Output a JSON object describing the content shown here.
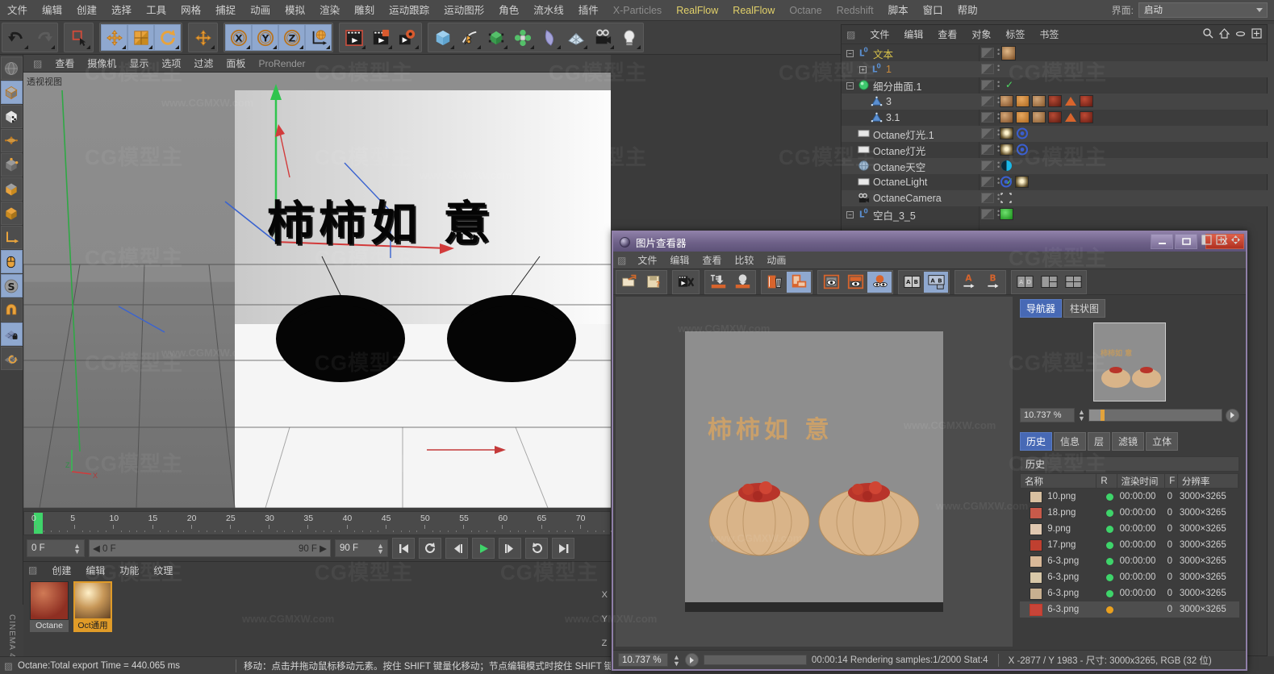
{
  "app": {
    "name": "CINEMA 4D"
  },
  "menubar": {
    "items": [
      {
        "label": "文件",
        "style": "normal"
      },
      {
        "label": "编辑",
        "style": "normal"
      },
      {
        "label": "创建",
        "style": "normal"
      },
      {
        "label": "选择",
        "style": "normal"
      },
      {
        "label": "工具",
        "style": "normal"
      },
      {
        "label": "网格",
        "style": "normal"
      },
      {
        "label": "捕捉",
        "style": "normal"
      },
      {
        "label": "动画",
        "style": "normal"
      },
      {
        "label": "模拟",
        "style": "normal"
      },
      {
        "label": "渲染",
        "style": "normal"
      },
      {
        "label": "雕刻",
        "style": "normal"
      },
      {
        "label": "运动跟踪",
        "style": "normal"
      },
      {
        "label": "运动图形",
        "style": "normal"
      },
      {
        "label": "角色",
        "style": "normal"
      },
      {
        "label": "流水线",
        "style": "normal"
      },
      {
        "label": "插件",
        "style": "normal"
      },
      {
        "label": "X-Particles",
        "style": "dim"
      },
      {
        "label": "RealFlow",
        "style": "accent"
      },
      {
        "label": "RealFlow",
        "style": "accent"
      },
      {
        "label": "Octane",
        "style": "dim"
      },
      {
        "label": "Redshift",
        "style": "dim"
      },
      {
        "label": "脚本",
        "style": "normal"
      },
      {
        "label": "窗口",
        "style": "normal"
      },
      {
        "label": "帮助",
        "style": "normal"
      }
    ],
    "interface_label": "界面:",
    "interface_value": "启动"
  },
  "toolbar": {
    "groups": [
      {
        "name": "undo-redo",
        "buttons": [
          {
            "name": "undo-icon"
          },
          {
            "name": "redo-icon"
          }
        ]
      },
      {
        "name": "select",
        "buttons": [
          {
            "name": "live-selection-icon"
          }
        ]
      },
      {
        "name": "transform",
        "buttons": [
          {
            "name": "move-icon",
            "active": true
          },
          {
            "name": "scale-icon",
            "active": true
          },
          {
            "name": "rotate-icon",
            "active": true
          }
        ]
      },
      {
        "name": "move-dup",
        "buttons": [
          {
            "name": "move-tool-icon"
          }
        ]
      },
      {
        "name": "axis-locks",
        "buttons": [
          {
            "name": "axis-x-icon",
            "active": true
          },
          {
            "name": "axis-y-icon",
            "active": true
          },
          {
            "name": "axis-z-icon",
            "active": true
          },
          {
            "name": "world-coordinate-icon",
            "active": true
          }
        ]
      },
      {
        "name": "render",
        "buttons": [
          {
            "name": "render-view-icon"
          },
          {
            "name": "render-to-picture-viewer-icon"
          },
          {
            "name": "render-settings-icon"
          }
        ]
      },
      {
        "name": "primitives",
        "buttons": [
          {
            "name": "cube-icon"
          },
          {
            "name": "spline-pen-icon"
          },
          {
            "name": "nurbs-icon"
          },
          {
            "name": "array-icon"
          },
          {
            "name": "bend-deformer-icon"
          },
          {
            "name": "floor-icon"
          },
          {
            "name": "camera-icon"
          },
          {
            "name": "light-icon"
          }
        ]
      }
    ]
  },
  "left_tools": {
    "items": [
      {
        "name": "world-axis-icon",
        "active": false
      },
      {
        "name": "model-mode-icon",
        "active": true
      },
      {
        "name": "texture-mode-icon",
        "active": false
      },
      {
        "name": "points-mode-icon",
        "active": false
      },
      {
        "name": "edges-mode-icon",
        "active": false
      },
      {
        "name": "polygons-mode-icon",
        "active": false
      },
      {
        "name": "object-axis-icon",
        "active": false
      },
      {
        "name": "enable-axis-icon",
        "active": false
      },
      {
        "name": "viewport-solo-icon",
        "active": true
      },
      {
        "name": "snap-icon",
        "active": true
      },
      {
        "name": "magnet-icon",
        "active": false
      },
      {
        "name": "workplane-lock-icon",
        "active": true
      },
      {
        "name": "workplane-icon",
        "active": false
      }
    ]
  },
  "viewport": {
    "menu": [
      "查看",
      "摄像机",
      "显示",
      "选项",
      "过滤",
      "面板",
      "ProRender"
    ],
    "label": "透视视图",
    "scene_text": "柿柿如 意"
  },
  "timeline": {
    "ticks": [
      "0",
      "5",
      "10",
      "15",
      "20",
      "25",
      "30",
      "35",
      "40",
      "45",
      "50",
      "55",
      "60",
      "65",
      "70"
    ],
    "current_frame": "0 F",
    "range_start": "0 F",
    "range_end": "90 F",
    "end_field": "90 F",
    "transport_buttons": [
      "go-to-start",
      "play-back-frame",
      "step-back",
      "play",
      "step-forward",
      "loop",
      "go-to-end"
    ]
  },
  "material_manager": {
    "menu": [
      "创建",
      "编辑",
      "功能",
      "纹理"
    ],
    "materials": [
      {
        "name": "Octane",
        "selected": false
      },
      {
        "name": "Oct通用",
        "selected": true
      }
    ],
    "axis_letters": [
      "X",
      "Y",
      "Z"
    ]
  },
  "status_bar": {
    "left": "Octane:Total export Time = 440.065 ms",
    "right": "移动：点击并拖动鼠标移动元素。按住 SHIFT 键量化移动；节点编辑模式时按住 SHIFT 键增加选择对象；按"
  },
  "object_manager": {
    "menu": [
      "文件",
      "编辑",
      "查看",
      "对象",
      "标签",
      "书签"
    ],
    "icons": [
      "search-icon",
      "home-icon",
      "ellipse-icon",
      "expand-icon"
    ],
    "rows": [
      {
        "name": "文本",
        "indent": 0,
        "color": "y",
        "expander": "minus",
        "obj_icon": "null-object",
        "checks": [],
        "has_thumb": true
      },
      {
        "name": "1",
        "indent": 1,
        "color": "o",
        "expander": "plus",
        "obj_icon": "null-object",
        "checks": []
      },
      {
        "name": "细分曲面.1",
        "indent": 0,
        "color": "n",
        "expander": "minus",
        "obj_icon": "subdivision",
        "checks": [
          "green"
        ]
      },
      {
        "name": "3",
        "indent": 1,
        "color": "n",
        "expander": "none",
        "obj_icon": "polygon",
        "checks": [],
        "tag_row": "materials"
      },
      {
        "name": "3.1",
        "indent": 1,
        "color": "n",
        "expander": "none",
        "obj_icon": "polygon",
        "checks": [],
        "tag_row": "materials"
      },
      {
        "name": "Octane灯光.1",
        "indent": 0,
        "color": "n",
        "expander": "none",
        "obj_icon": "light",
        "checks": [
          "green"
        ],
        "tag_row": "light"
      },
      {
        "name": "Octane灯光",
        "indent": 0,
        "color": "n",
        "expander": "none",
        "obj_icon": "light",
        "checks": [
          "green"
        ],
        "tag_row": "light"
      },
      {
        "name": "Octane天空",
        "indent": 0,
        "color": "n",
        "expander": "none",
        "obj_icon": "sky",
        "checks": [],
        "tag_row": "sky"
      },
      {
        "name": "OctaneLight",
        "indent": 0,
        "color": "n",
        "expander": "none",
        "obj_icon": "light",
        "checks": [
          "green"
        ],
        "tag_row": "light2"
      },
      {
        "name": "OctaneCamera",
        "indent": 0,
        "color": "n",
        "expander": "none",
        "obj_icon": "camera",
        "checks": [],
        "tag_row": "camera"
      },
      {
        "name": "空白_3_5",
        "indent": 0,
        "color": "n",
        "expander": "minus",
        "obj_icon": "null-object",
        "checks": [],
        "tag_row": "green"
      }
    ]
  },
  "picture_viewer": {
    "title": "图片查看器",
    "window_buttons": [
      "minimize",
      "maximize",
      "close"
    ],
    "menu": [
      "文件",
      "编辑",
      "查看",
      "比较",
      "动画"
    ],
    "tools": [
      [
        "open-image-icon",
        "save-image-icon"
      ],
      [
        "render-queue-icon"
      ],
      [
        "send-to-a-icon",
        "send-to-b-icon"
      ],
      [
        "delete-icon",
        "duplicate-icon"
      ],
      [
        "view-a-icon",
        "view-b-icon",
        "view-ab-icon"
      ],
      [
        "compare-ab-icon",
        "compare-split-icon"
      ],
      [
        "a-button",
        "b-button"
      ],
      [
        "layout-ab-icon",
        "layout-stack-icon",
        "layout-grid-icon"
      ]
    ],
    "nav_tabs": [
      {
        "label": "导航器",
        "active": true
      },
      {
        "label": "柱状图",
        "active": false
      }
    ],
    "nav_zoom": "10.737 %",
    "info_tabs": [
      {
        "label": "历史",
        "active": true
      },
      {
        "label": "信息",
        "active": false
      },
      {
        "label": "层",
        "active": false
      },
      {
        "label": "滤镜",
        "active": false
      },
      {
        "label": "立体",
        "active": false
      }
    ],
    "history_title": "历史",
    "history_columns": [
      "名称",
      "R",
      "渲染时间",
      "F",
      "分辨率"
    ],
    "history_rows": [
      {
        "name": "10.png",
        "status": "green",
        "time": "00:00:00",
        "f": "0",
        "res": "3000×3265",
        "selected": false
      },
      {
        "name": "18.png",
        "status": "green",
        "time": "00:00:00",
        "f": "0",
        "res": "3000×3265",
        "selected": false
      },
      {
        "name": "9.png",
        "status": "green",
        "time": "00:00:00",
        "f": "0",
        "res": "3000×3265",
        "selected": false
      },
      {
        "name": "17.png",
        "status": "green",
        "time": "00:00:00",
        "f": "0",
        "res": "3000×3265",
        "selected": false
      },
      {
        "name": "6-3.png",
        "status": "green",
        "time": "00:00:00",
        "f": "0",
        "res": "3000×3265",
        "selected": false
      },
      {
        "name": "6-3.png",
        "status": "green",
        "time": "00:00:00",
        "f": "0",
        "res": "3000×3265",
        "selected": false
      },
      {
        "name": "6-3.png",
        "status": "green",
        "time": "00:00:00",
        "f": "0",
        "res": "3000×3265",
        "selected": false
      },
      {
        "name": "6-3.png",
        "status": "orange",
        "time": "",
        "f": "0",
        "res": "3000×3265",
        "selected": true
      }
    ],
    "status": {
      "zoom": "10.737 %",
      "render_info": "00:00:14 Rendering samples:1/2000 Stat:4",
      "coords": "X -2877 / Y 1983 - 尺寸: 3000x3265, RGB (32 位)"
    }
  },
  "watermarks": {
    "big": "CG模型主",
    "small": "www.CGMXW.com"
  },
  "colors": {
    "accent_yellow": "#e2d16a",
    "orange": "#e09b28",
    "green": "#3ed46a",
    "pv_purple": "#6e6188",
    "tab_blue": "#4769b5"
  }
}
